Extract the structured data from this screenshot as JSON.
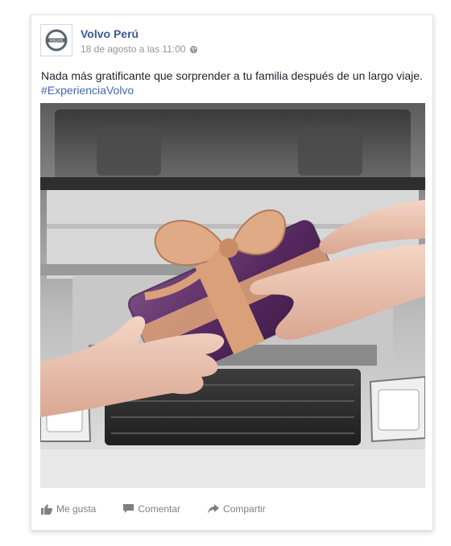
{
  "post": {
    "page_name": "Volvo Perú",
    "timestamp": "18 de agosto a las 11:00",
    "privacy_icon": "globe-icon",
    "text": "Nada más gratificante que sorprender a tu familia después de un largo viaje. ",
    "hashtag": "#ExperienciaVolvo",
    "avatar_logo": "VOLVO"
  },
  "actions": {
    "like_label": "Me gusta",
    "comment_label": "Comentar",
    "share_label": "Compartir"
  },
  "colors": {
    "link": "#3b5998",
    "hashtag": "#4267b2",
    "meta_text": "#90949c",
    "action_text": "#7f7f7f",
    "gift_wrap": "#5a2d63",
    "ribbon": "#d9a07a"
  }
}
